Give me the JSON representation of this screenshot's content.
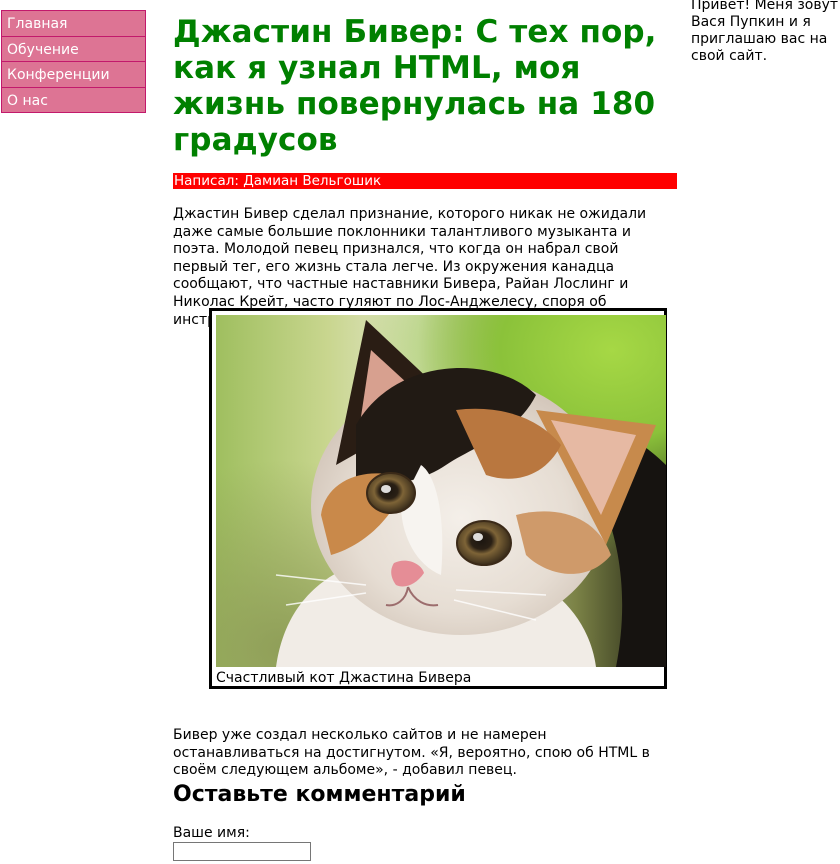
{
  "nav": {
    "items": [
      {
        "label": "Главная"
      },
      {
        "label": "Обучение"
      },
      {
        "label": "Конференции"
      },
      {
        "label": "О нас"
      }
    ]
  },
  "aside": {
    "text": "Привет! Меня зовут Вася Пупкин и я приглашаю вас на свой сайт."
  },
  "article": {
    "title": "Джастин Бивер: С тех пор, как я узнал HTML, моя жизнь повернулась на 180 градусов",
    "byline": "Написал: Дамиан Вельгошик",
    "paragraph1": "Джастин Бивер сделал признание, которого никак не ожидали даже самые большие поклонники талантливого музыканта и поэта. Молодой певец признался, что когда он набрал свой первый тег, его жизнь стала легче. Из окружения канадца сообщают, что частные наставники Бивера, Райан Лослинг и Николас Крейт, часто гуляют по Лос-Анджелесу, споря об инструменте HTML-валидатор.",
    "figure": {
      "caption": "Счастливый кот Джастина Бивера",
      "image": "kitten-photo"
    },
    "paragraph2": "Бивер уже создал несколько сайтов и не намерен останавливаться на достигнутом. «Я, вероятно, спою об HTML в своём следующем альбоме», - добавил певец."
  },
  "comment": {
    "heading": "Оставьте комментарий",
    "name_label": "Ваше имя:",
    "name_value": ""
  },
  "colors": {
    "title": "#008000",
    "byline_bg": "#ff0000",
    "nav_bg": "#dd7494",
    "nav_border": "#c2196c"
  }
}
